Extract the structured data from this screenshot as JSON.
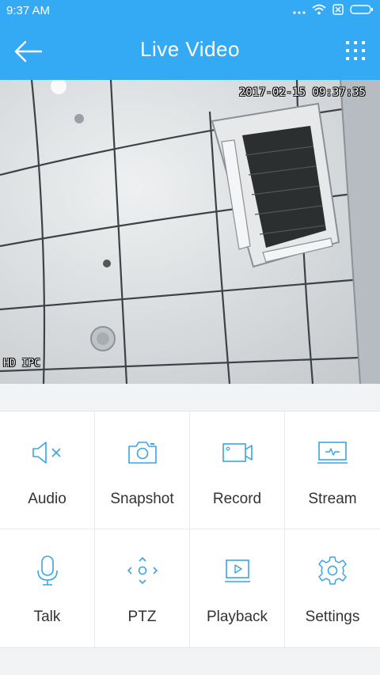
{
  "status_bar": {
    "time": "9:37 AM"
  },
  "app_bar": {
    "title": "Live Video"
  },
  "video": {
    "timestamp": "2017-02-15 09:37:35",
    "channel_label": "HD IPC"
  },
  "controls": [
    {
      "label": "Audio",
      "icon": "speaker-muted-icon"
    },
    {
      "label": "Snapshot",
      "icon": "camera-icon"
    },
    {
      "label": "Record",
      "icon": "video-camera-icon"
    },
    {
      "label": "Stream",
      "icon": "monitor-icon"
    },
    {
      "label": "Talk",
      "icon": "microphone-icon"
    },
    {
      "label": "PTZ",
      "icon": "direction-pad-icon"
    },
    {
      "label": "Playback",
      "icon": "play-screen-icon"
    },
    {
      "label": "Settings",
      "icon": "gear-icon"
    }
  ],
  "colors": {
    "accent": "#34a9f4",
    "icon": "#3aa3e6"
  }
}
